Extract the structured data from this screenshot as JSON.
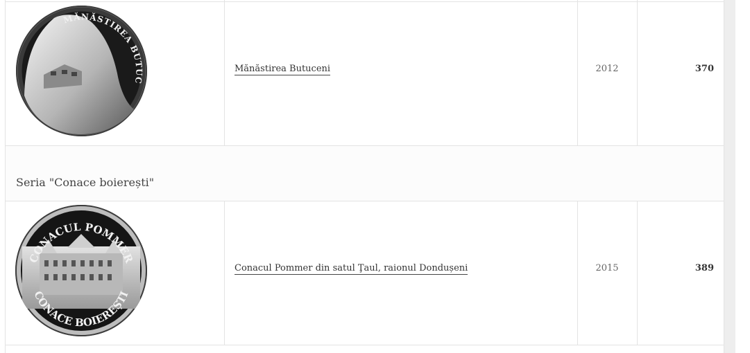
{
  "rows": [
    {
      "coin_text": "MĂNĂSTIREA BUTUCENI",
      "name": "Mănăstirea Butuceni",
      "year": "2012",
      "count": "370"
    },
    {
      "coin_text_top": "CONACUL POMMER",
      "coin_text_bottom": "CONACE BOIEREȘTI",
      "name": "Conacul Pommer din satul Ţaul, raionul Dondușeni",
      "year": "2015",
      "count": "389"
    }
  ],
  "series": {
    "title": "Seria \"Conace boierești\""
  },
  "colors": {
    "border": "#e3e3e3",
    "gutter": "#eeeeee",
    "text": "#333333"
  }
}
